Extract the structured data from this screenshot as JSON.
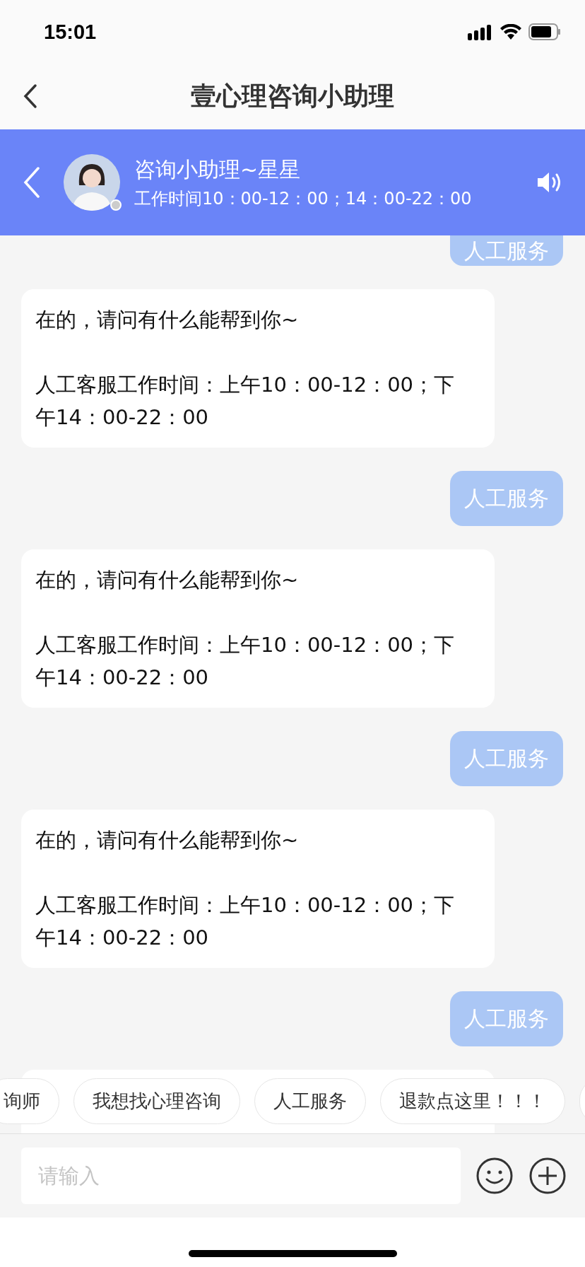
{
  "status_bar": {
    "time": "15:01"
  },
  "nav": {
    "title": "壹心理咨询小助理"
  },
  "agent": {
    "name": "咨询小助理~星星",
    "hours": "工作时间10：00-12：00；14：00-22：00",
    "online": false
  },
  "messages": [
    {
      "kind": "user",
      "text": "人工服务",
      "cut_top": true
    },
    {
      "kind": "bot",
      "paragraphs": [
        "在的，请问有什么能帮到你~",
        "人工客服工作时间：上午10：00-12：00；下午14：00-22：00"
      ]
    },
    {
      "kind": "user",
      "text": "人工服务"
    },
    {
      "kind": "bot",
      "paragraphs": [
        "在的，请问有什么能帮到你~",
        "人工客服工作时间：上午10：00-12：00；下午14：00-22：00"
      ]
    },
    {
      "kind": "user",
      "text": "人工服务"
    },
    {
      "kind": "bot",
      "paragraphs": [
        "在的，请问有什么能帮到你~",
        "人工客服工作时间：上午10：00-12：00；下午14：00-22：00"
      ]
    },
    {
      "kind": "user",
      "text": "人工服务"
    },
    {
      "kind": "bot"
    }
  ],
  "quick_replies": [
    "询师",
    "我想找心理咨询",
    "人工服务",
    "退款点这里！！！"
  ],
  "input": {
    "placeholder": "请输入"
  }
}
